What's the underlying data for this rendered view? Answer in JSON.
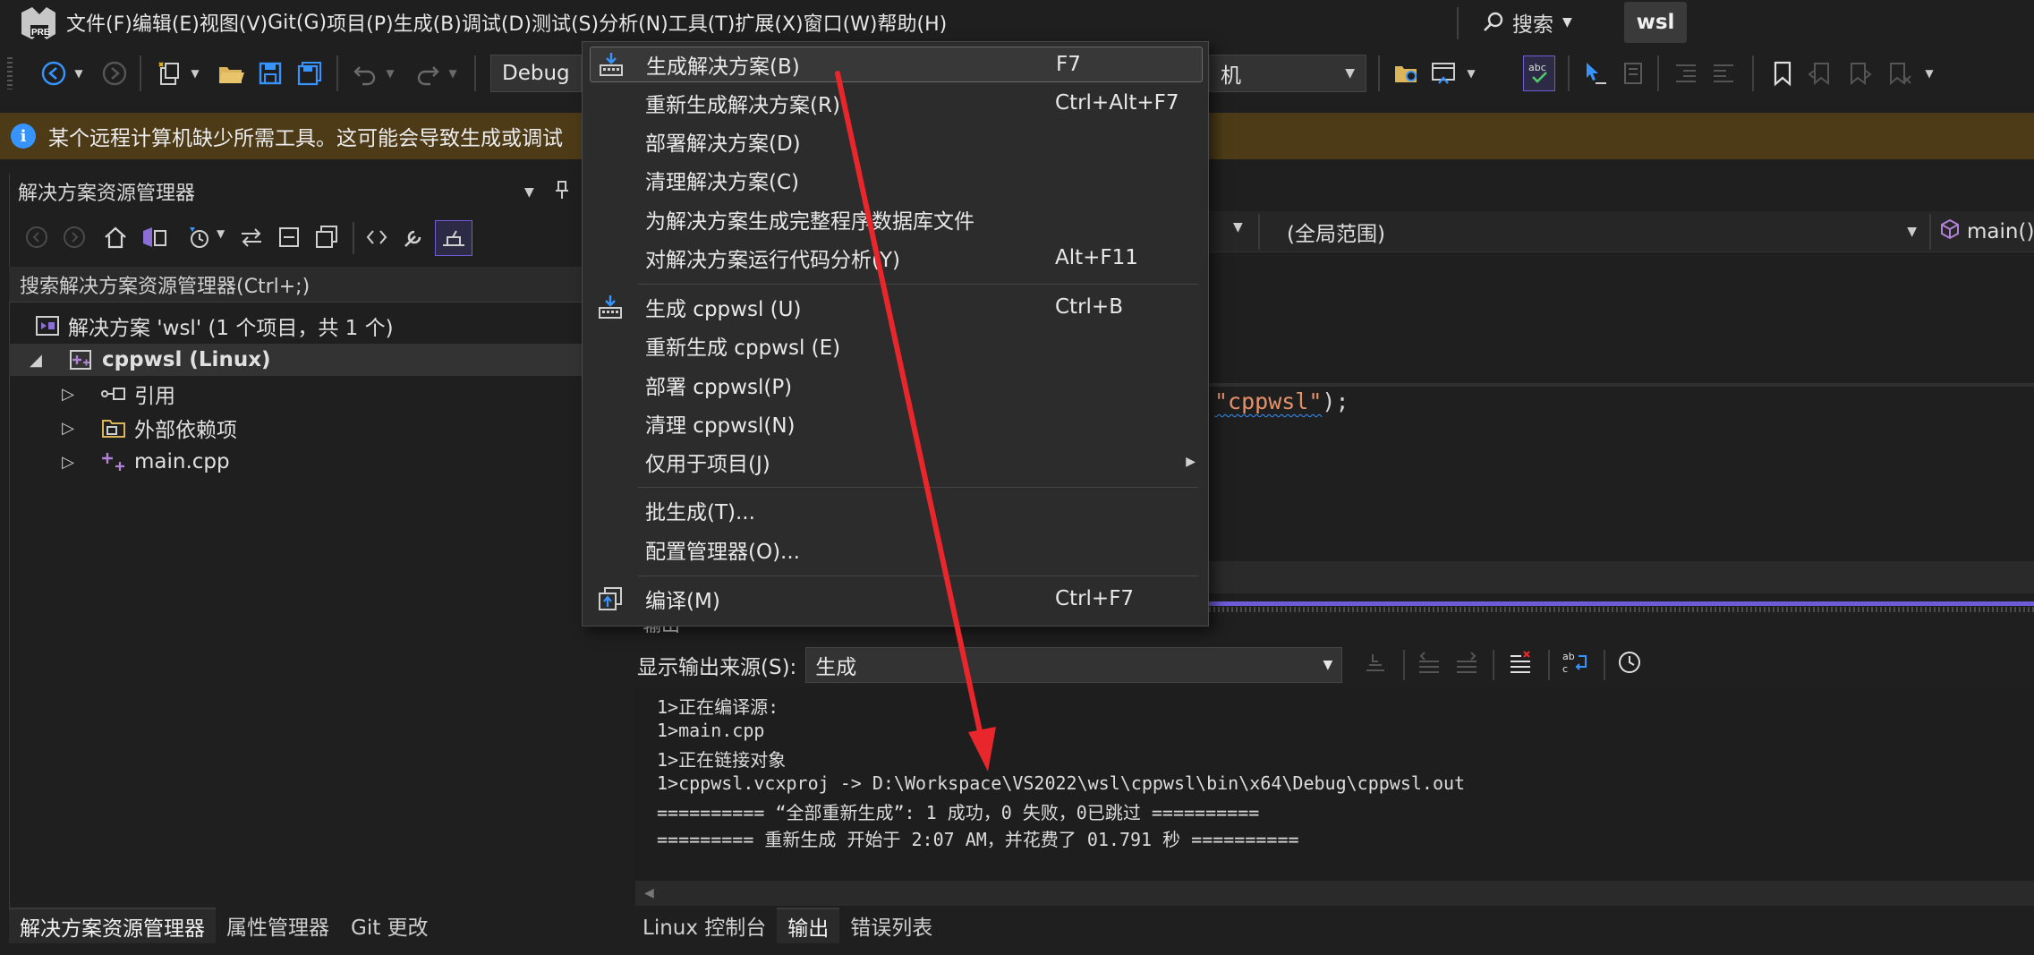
{
  "menubar": {
    "items": [
      "文件(F)",
      "编辑(E)",
      "视图(V)",
      "Git(G)",
      "项目(P)",
      "生成(B)",
      "调试(D)",
      "测试(S)",
      "分析(N)",
      "工具(T)",
      "扩展(X)",
      "窗口(W)",
      "帮助(H)"
    ],
    "search_label": "搜索",
    "solution_badge": "wsl"
  },
  "toolbar": {
    "config": "Debug",
    "target_suffix": "机"
  },
  "infobar": {
    "text": "某个远程计算机缺少所需工具。这可能会导致生成或调试"
  },
  "solution_explorer": {
    "title": "解决方案资源管理器",
    "search_placeholder": "搜索解决方案资源管理器(Ctrl+;)",
    "tree": [
      {
        "label": "解决方案 'wsl' (1 个项目，共 1 个)"
      },
      {
        "label": "cppwsl (Linux)"
      },
      {
        "label": "引用"
      },
      {
        "label": "外部依赖项"
      },
      {
        "label": "main.cpp"
      }
    ],
    "tabs": [
      "解决方案资源管理器",
      "属性管理器",
      "Git 更改"
    ]
  },
  "editor": {
    "scope": "(全局范围)",
    "function": "main()",
    "code_string": "\"cppwsl\"",
    "code_tail": ");"
  },
  "output": {
    "title": "输出",
    "source_label": "显示输出来源(S):",
    "source_value": "生成",
    "lines": [
      "1>正在编译源:",
      "1>main.cpp",
      "1>正在链接对象",
      "1>cppwsl.vcxproj -> D:\\Workspace\\VS2022\\wsl\\cppwsl\\bin\\x64\\Debug\\cppwsl.out",
      "========== “全部重新生成”: 1 成功，0 失败，0已跳过 ==========",
      "========= 重新生成 开始于 2:07 AM，并花费了 01.791 秒 =========="
    ],
    "tabs": [
      "Linux 控制台",
      "输出",
      "错误列表"
    ]
  },
  "build_menu": {
    "items": [
      {
        "label": "生成解决方案(B)",
        "shortcut": "F7"
      },
      {
        "label": "重新生成解决方案(R)",
        "shortcut": "Ctrl+Alt+F7"
      },
      {
        "label": "部署解决方案(D)",
        "shortcut": ""
      },
      {
        "label": "清理解决方案(C)",
        "shortcut": ""
      },
      {
        "label": "为解决方案生成完整程序数据库文件",
        "shortcut": ""
      },
      {
        "label": "对解决方案运行代码分析(Y)",
        "shortcut": "Alt+F11"
      },
      {
        "label": "生成 cppwsl (U)",
        "shortcut": "Ctrl+B"
      },
      {
        "label": "重新生成 cppwsl (E)",
        "shortcut": ""
      },
      {
        "label": "部署 cppwsl(P)",
        "shortcut": ""
      },
      {
        "label": "清理 cppwsl(N)",
        "shortcut": ""
      },
      {
        "label": "仅用于项目(J)",
        "shortcut": ""
      },
      {
        "label": "批生成(T)...",
        "shortcut": ""
      },
      {
        "label": "配置管理器(O)...",
        "shortcut": ""
      },
      {
        "label": "编译(M)",
        "shortcut": "Ctrl+F7"
      }
    ]
  },
  "colors": {
    "accent": "#6e5bd8",
    "arrow": "#e8262b",
    "info": "#3794ff"
  }
}
